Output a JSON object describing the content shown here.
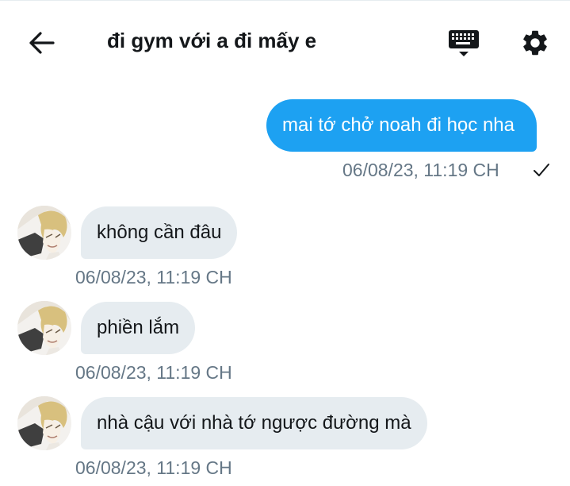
{
  "header": {
    "title": "đi gym với a đi mấy e",
    "back_icon": "arrow-left-icon",
    "keyboard_icon": "keyboard-icon",
    "settings_icon": "gear-icon"
  },
  "messages": [
    {
      "direction": "outgoing",
      "text": "mai tớ chở noah đi học nha",
      "time": "06/08/23, 11:19 CH",
      "status": "sent"
    },
    {
      "direction": "incoming",
      "text": "không cần đâu",
      "time": "06/08/23, 11:19 CH"
    },
    {
      "direction": "incoming",
      "text": "phiền lắm",
      "time": "06/08/23, 11:19 CH"
    },
    {
      "direction": "incoming",
      "text": "nhà cậu với nhà tớ ngược đường mà",
      "time": "06/08/23, 11:19 CH"
    }
  ],
  "colors": {
    "accent": "#1da1f2",
    "incoming_bubble": "#e6ecf0",
    "timestamp": "#657786"
  }
}
